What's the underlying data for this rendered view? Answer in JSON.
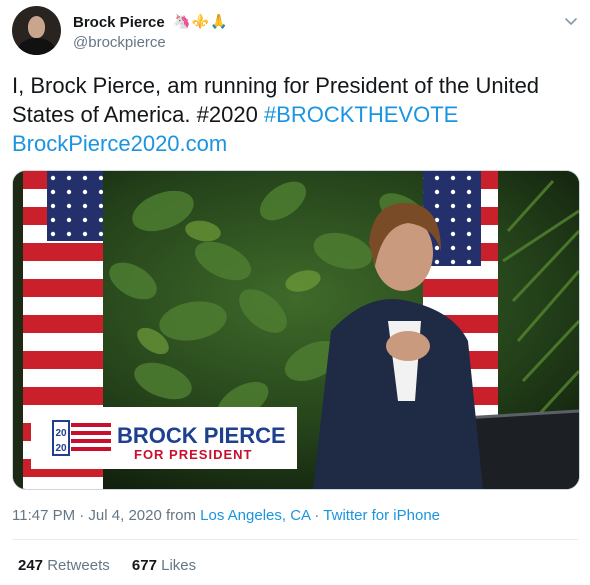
{
  "author": {
    "display_name": "Brock Pierce",
    "handle": "@brockpierce",
    "emojis": "🦄⚜️🙏"
  },
  "tweet": {
    "text_line": "I, Brock Pierce, am running for President of the United States of America. #2020 ",
    "hashtag": "#BROCKTHEVOTE",
    "url": "BrockPierce2020.com"
  },
  "media": {
    "banner_name": "BROCK PIERCE",
    "banner_sub": "FOR PRESIDENT",
    "banner_logo_top": "20",
    "banner_logo_bottom": "20"
  },
  "meta": {
    "timestamp": "11:47 PM · Jul 4, 2020 from ",
    "location": "Los Angeles, CA",
    "separator": " · ",
    "source": "Twitter for iPhone"
  },
  "stats": {
    "retweets_count": "247",
    "retweets_label": "Retweets",
    "likes_count": "677",
    "likes_label": "Likes"
  },
  "colors": {
    "link": "#1b95e0",
    "muted": "#657786",
    "banner_blue": "#1f3f8f",
    "banner_red": "#c8102e"
  },
  "icons": {
    "caret": "chevron-down-icon"
  }
}
